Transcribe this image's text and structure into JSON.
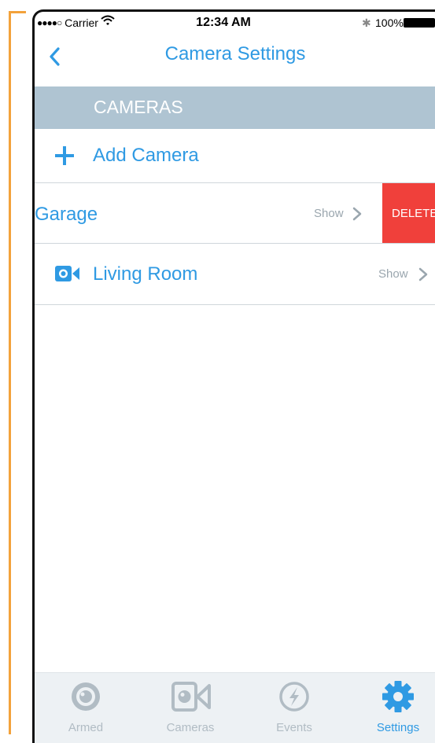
{
  "status_bar": {
    "carrier": "Carrier",
    "time": "12:34 AM",
    "battery": "100%"
  },
  "nav": {
    "title": "Camera Settings"
  },
  "section": {
    "header": "CAMERAS"
  },
  "add_camera": {
    "label": "Add Camera"
  },
  "cameras": [
    {
      "name": "Garage",
      "action": "Show",
      "swipe_action": "DELETE"
    },
    {
      "name": "Living Room",
      "action": "Show"
    }
  ],
  "tabs": [
    {
      "label": "Armed",
      "icon": "armed-icon",
      "active": false
    },
    {
      "label": "Cameras",
      "icon": "camera-icon",
      "active": false
    },
    {
      "label": "Events",
      "icon": "bolt-icon",
      "active": false
    },
    {
      "label": "Settings",
      "icon": "gear-icon",
      "active": true
    }
  ],
  "colors": {
    "accent": "#2f9ae3",
    "section_bg": "#afc4d2",
    "delete": "#f0403b",
    "inactive_tab": "#b1bcc4",
    "annotation": "#f3a23b"
  }
}
